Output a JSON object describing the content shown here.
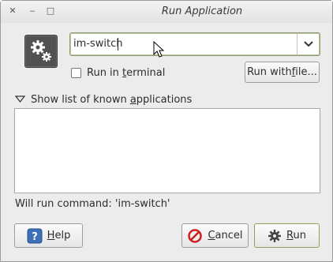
{
  "window": {
    "title": "Run Application",
    "close_glyph": "✕",
    "minimize_glyph": "‒",
    "maximize_glyph": "□"
  },
  "command": {
    "value": "im-switch",
    "icon": "gear-icon"
  },
  "options": {
    "run_in_terminal_pre": "Run in ",
    "run_in_terminal_u": "t",
    "run_in_terminal_post": "erminal",
    "run_in_terminal_checked": false,
    "run_with_file_pre": "Run with ",
    "run_with_file_u": "f",
    "run_with_file_post": "ile..."
  },
  "expander": {
    "pre": "Show list of known ",
    "u": "a",
    "post": "pplications",
    "expanded": true
  },
  "status": {
    "text": "Will run command: 'im-switch'"
  },
  "buttons": {
    "help_u": "H",
    "help_post": "elp",
    "cancel_u": "C",
    "cancel_post": "ancel",
    "run_u": "R",
    "run_post": "un"
  },
  "colors": {
    "accent_border": "#8aa35a",
    "help_icon": "#3b6fb6",
    "cancel_icon": "#cc1f1f"
  }
}
